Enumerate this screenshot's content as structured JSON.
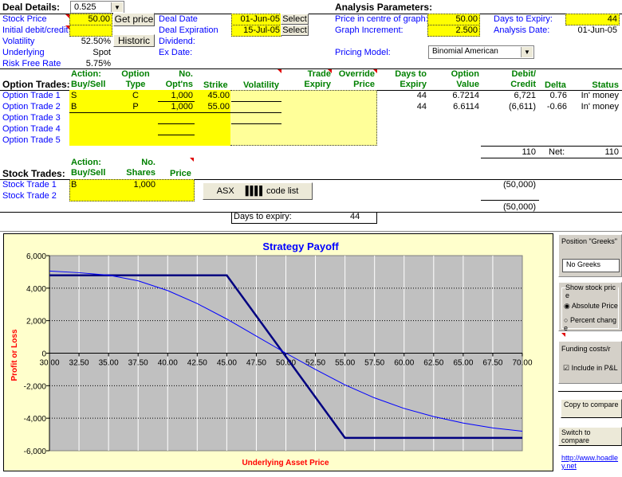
{
  "deal": {
    "title": "Deal Details:",
    "dropdown_value": "0.525",
    "stock_price_label": "Stock Price",
    "stock_price": "50.00",
    "initial_label": "Initial debit/credit",
    "initial": "",
    "volatility_label": "Volatility",
    "volatility": "52.50%",
    "underlying_label": "Underlying",
    "underlying": "Spot",
    "rfr_label": "Risk Free Rate",
    "rfr": "5.75%",
    "get_price": "Get price",
    "historic": "Historic",
    "deal_date_label": "Deal Date",
    "deal_date": "01-Jun-05",
    "deal_exp_label": "Deal Expiration",
    "deal_exp": "15-Jul-05",
    "select": "Select",
    "dividend_label": "Dividend:",
    "exdate_label": "Ex Date:"
  },
  "analysis": {
    "title": "Analysis Parameters:",
    "centre_label": "Price in centre of graph:",
    "centre": "50.00",
    "incr_label": "Graph Increment:",
    "incr": "2.500",
    "dte_label": "Days to Expiry:",
    "dte": "44",
    "adate_label": "Analysis Date:",
    "adate": "01-Jun-05",
    "model_label": "Pricing Model:",
    "model": "Binomial American"
  },
  "options": {
    "title": "Option Trades:",
    "headers": {
      "action1": "Action:",
      "action2": "Buy/Sell",
      "type1": "Option",
      "type2": "Type",
      "no1": "No.",
      "no2": "Opt'ns",
      "strike": "Strike",
      "vol": "Volatility",
      "te1": "Trade",
      "te2": "Expiry",
      "op1": "Override",
      "op2": "Price",
      "dte1": "Days to",
      "dte2": "Expiry",
      "ov1": "Option",
      "ov2": "Value",
      "dc1": "Debit/",
      "dc2": "Credit",
      "delta": "Delta",
      "status": "Status"
    },
    "rows": [
      {
        "label": "Option Trade 1",
        "action": "S",
        "type": "C",
        "no": "1,000",
        "strike": "45.00",
        "dte": "44",
        "value": "6.7214",
        "dc": "6,721",
        "delta": "0.76",
        "status": "In' money"
      },
      {
        "label": "Option Trade 2",
        "action": "B",
        "type": "P",
        "no": "1,000",
        "strike": "55.00",
        "dte": "44",
        "value": "6.6114",
        "dc": "(6,611)",
        "delta": "-0.66",
        "status": "In' money"
      },
      {
        "label": "Option Trade 3"
      },
      {
        "label": "Option Trade 4"
      },
      {
        "label": "Option Trade 5"
      }
    ],
    "total": "110",
    "net_label": "Net:",
    "net": "110"
  },
  "stocks": {
    "title": "Stock Trades:",
    "headers": {
      "action1": "Action:",
      "action2": "Buy/Sell",
      "no1": "No.",
      "no2": "Shares",
      "price": "Price"
    },
    "rows": [
      {
        "label": "Stock Trade 1",
        "action": "B",
        "shares": "1,000",
        "dc": "(50,000)"
      },
      {
        "label": "Stock Trade 2"
      }
    ],
    "total": "(50,000)",
    "asx": "ASX",
    "codelist": "code list"
  },
  "expiry_box": {
    "label": "Days to expiry:",
    "value": "44"
  },
  "panel": {
    "greeks_title": "Position \"Greeks\"",
    "greeks_value": "No Greeks",
    "show_title": "Show stock price",
    "abs": "Absolute Price",
    "pct": "Percent change",
    "funding_title": "Funding costs/r",
    "include": "Include in P&L",
    "copy": "Copy to compare",
    "switch": "Switch to compare",
    "link": "http://www.hoadley.net"
  },
  "chart_data": {
    "type": "line",
    "title": "Strategy Payoff",
    "xlabel": "Underlying Asset Price",
    "ylabel": "Profit or Loss",
    "xlim": [
      30,
      70
    ],
    "ylim": [
      -6000,
      6000
    ],
    "grid": true,
    "xticks": [
      "30.00",
      "32.50",
      "35.00",
      "37.50",
      "40.00",
      "42.50",
      "45.00",
      "47.50",
      "50.00",
      "52.50",
      "55.00",
      "57.50",
      "60.00",
      "62.50",
      "65.00",
      "67.50",
      "70.00"
    ],
    "yticks": [
      "6,000",
      "4,000",
      "2,000",
      "0",
      "-2,000",
      "-4,000",
      "-6,000"
    ],
    "series": [
      {
        "color": "#000080",
        "x": [
          30,
          45,
          55,
          70
        ],
        "y": [
          4790,
          4790,
          -5210,
          -5210
        ]
      },
      {
        "color": "#0000ff",
        "x": [
          30,
          32.5,
          35,
          37.5,
          40,
          42.5,
          45,
          47.5,
          50,
          52.5,
          55,
          57.5,
          60,
          62.5,
          65,
          67.5,
          70
        ],
        "y": [
          5050,
          4950,
          4800,
          4450,
          3850,
          3050,
          2100,
          1050,
          0,
          -1000,
          -1950,
          -2750,
          -3400,
          -3900,
          -4300,
          -4600,
          -4800
        ]
      }
    ]
  }
}
